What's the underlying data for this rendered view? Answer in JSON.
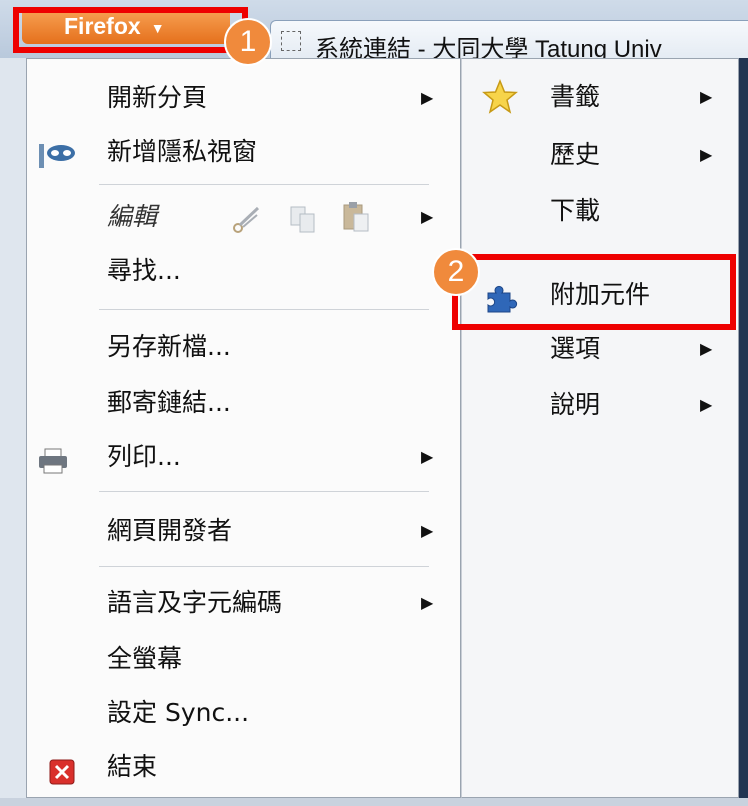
{
  "toolbar": {
    "firefox_label": "Firefox",
    "arrow": "▼",
    "tab_title": "系統連結 - 大同大學 Tatung Univ"
  },
  "annotations": {
    "badge1": "1",
    "badge2": "2",
    "highlight_color": "#ee0000",
    "badge_color": "#f08a3c"
  },
  "main_menu": {
    "items": [
      {
        "label": "開新分頁",
        "submenu": true
      },
      {
        "label": "新增隱私視窗",
        "icon": "private-mask-icon"
      },
      {
        "label": "編輯",
        "submenu": true,
        "icons": [
          "cut-icon",
          "copy-icon",
          "paste-icon"
        ]
      },
      {
        "label": "尋找..."
      },
      {
        "label": "另存新檔..."
      },
      {
        "label": "郵寄鏈結..."
      },
      {
        "label": "列印...",
        "submenu": true,
        "icon": "printer-icon"
      },
      {
        "label": "網頁開發者",
        "submenu": true
      },
      {
        "label": "語言及字元編碼",
        "submenu": true
      },
      {
        "label": "全螢幕"
      },
      {
        "label": "設定 Sync..."
      },
      {
        "label": "結束",
        "icon": "exit-icon"
      }
    ]
  },
  "right_menu": {
    "items": [
      {
        "label": "書籤",
        "submenu": true,
        "icon": "star-icon"
      },
      {
        "label": "歷史",
        "submenu": true
      },
      {
        "label": "下載"
      },
      {
        "label": "附加元件",
        "icon": "puzzle-icon"
      },
      {
        "label": "選項",
        "submenu": true
      },
      {
        "label": "說明",
        "submenu": true
      }
    ]
  },
  "submenu_arrow": "▶"
}
